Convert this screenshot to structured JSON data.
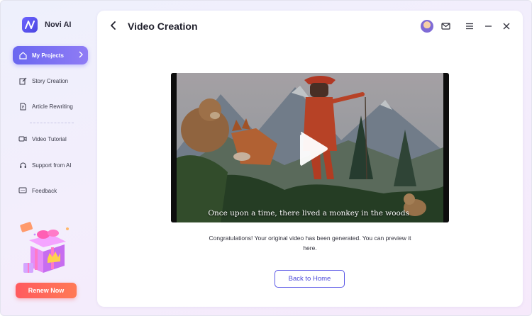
{
  "app": {
    "name": "Novi AI"
  },
  "sidebar": {
    "items": [
      {
        "label": "My Projects",
        "icon": "home-icon",
        "active": true
      },
      {
        "label": "Story Creation",
        "icon": "edit-icon",
        "active": false
      },
      {
        "label": "Article Rewriting",
        "icon": "document-edit-icon",
        "active": false
      },
      {
        "label": "Video Tutorial",
        "icon": "video-camera-icon",
        "active": false
      },
      {
        "label": "Support from AI",
        "icon": "headset-icon",
        "active": false
      },
      {
        "label": "Feedback",
        "icon": "feedback-icon",
        "active": false
      }
    ],
    "renew_label": "Renew Now"
  },
  "header": {
    "title": "Video Creation"
  },
  "video": {
    "subtitle": "Once upon a time, there lived a monkey in the woods"
  },
  "main": {
    "message": "Congratulations! Your original video has been generated. You can preview it here.",
    "back_home_label": "Back to Home"
  },
  "colors": {
    "accent": "#6a67f0",
    "renew": "#ff5a5f",
    "title": "#1f1f2b"
  }
}
